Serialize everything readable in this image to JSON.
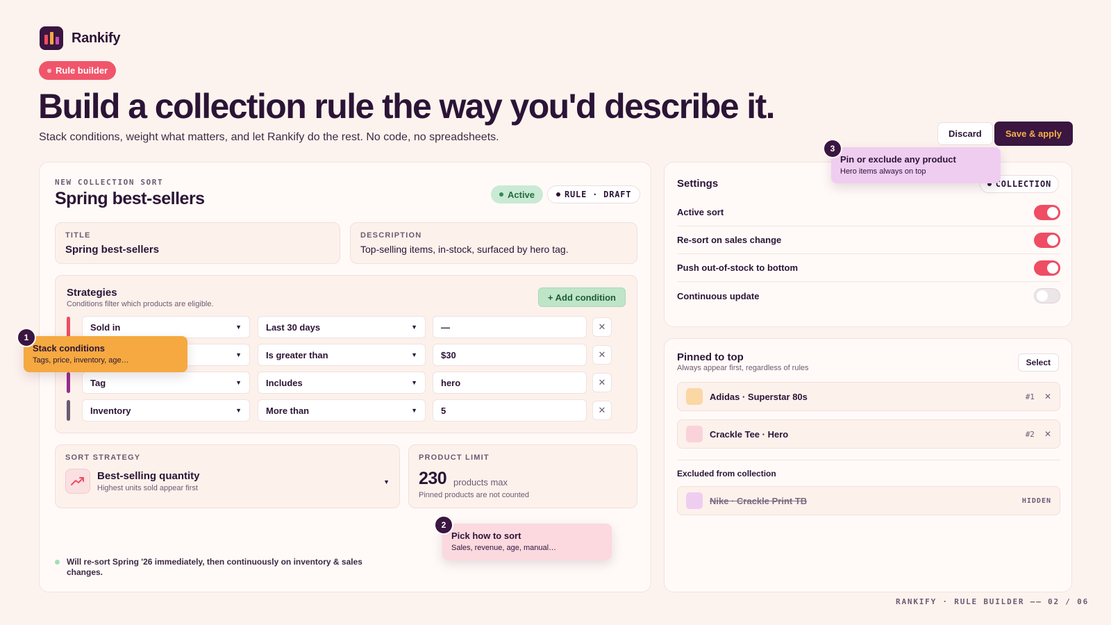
{
  "brand": {
    "name": "Rankify"
  },
  "tag": "Rule builder",
  "headline": "Build a collection rule the way you'd describe it.",
  "subline": "Stack conditions, weight what matters, and let Rankify do the rest. No code, no spreadsheets.",
  "actions": {
    "discard": "Discard",
    "save": "Save & apply"
  },
  "sort": {
    "eyebrow": "NEW COLLECTION SORT",
    "title": "Spring best-sellers",
    "status": "Active",
    "mode": "RULE · DRAFT",
    "fields": {
      "title_label": "TITLE",
      "title_value": "Spring best-sellers",
      "desc_label": "DESCRIPTION",
      "desc_value": "Top-selling items, in-stock, surfaced by hero tag."
    }
  },
  "strategies": {
    "title": "Strategies",
    "subtitle": "Conditions filter which products are eligible.",
    "add_label": "+ Add condition",
    "conditions": [
      {
        "field": "Sold in",
        "operator": "Last 30 days",
        "value": "—",
        "color": "#ef4d63"
      },
      {
        "field": "",
        "operator": "Is greater than",
        "value": "$30",
        "color": "#f5a940"
      },
      {
        "field": "Tag",
        "operator": "Includes",
        "value": "hero",
        "color": "#9b2a8f"
      },
      {
        "field": "Inventory",
        "operator": "More than",
        "value": "5",
        "color": "#6d5a72"
      }
    ]
  },
  "sort_strategy": {
    "label": "SORT STRATEGY",
    "name": "Best-selling quantity",
    "sub": "Highest units sold appear first"
  },
  "product_limit": {
    "label": "PRODUCT LIMIT",
    "value": "230",
    "unit": "products max",
    "sub": "Pinned products are not counted"
  },
  "footer_note": "Will re-sort Spring '26 immediately, then continuously on inventory & sales changes.",
  "settings": {
    "title": "Settings",
    "badge": "COLLECTION",
    "rows": [
      {
        "label": "Active sort",
        "on": true
      },
      {
        "label": "Re-sort on sales change",
        "on": true
      },
      {
        "label": "Push out-of-stock to bottom",
        "on": true
      },
      {
        "label": "Continuous update",
        "on": false
      }
    ]
  },
  "pinned": {
    "title": "Pinned to top",
    "subtitle": "Always appear first, regardless of rules",
    "select_label": "Select",
    "items": [
      {
        "name": "Adidas · Superstar 80s",
        "rank": "#1",
        "color": "#fbd7a4"
      },
      {
        "name": "Crackle Tee · Hero",
        "rank": "#2",
        "color": "#f9d3d9"
      }
    ],
    "excluded_title": "Excluded from collection",
    "excluded": [
      {
        "name": "Nike · Crackle Print TB",
        "tag": "HIDDEN",
        "color": "#efcdf1"
      }
    ]
  },
  "callouts": [
    {
      "num": "1",
      "title": "Stack conditions",
      "sub": "Tags, price, inventory, age…"
    },
    {
      "num": "2",
      "title": "Pick how to sort",
      "sub": "Sales, revenue, age, manual…"
    },
    {
      "num": "3",
      "title": "Pin or exclude any product",
      "sub": "Hero items always on top"
    }
  ],
  "page_footer": "RANKIFY · RULE BUILDER —— 02 / 06"
}
